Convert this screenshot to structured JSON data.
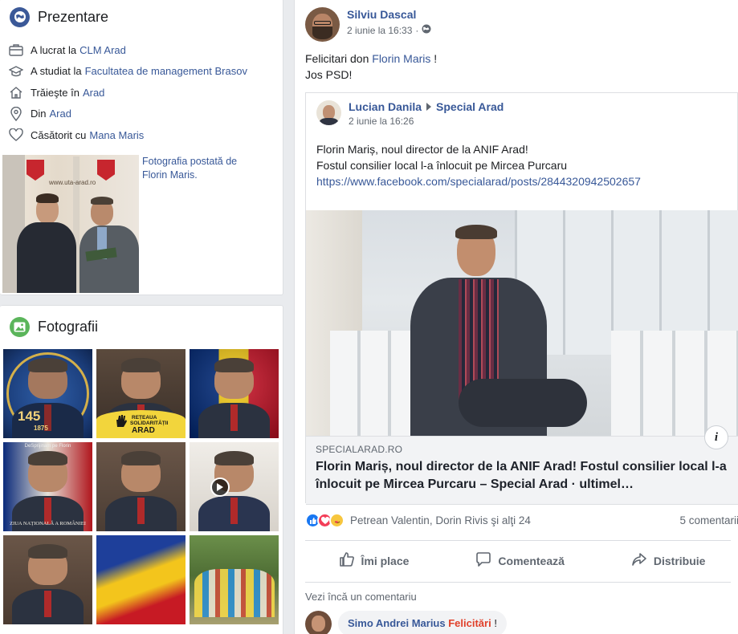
{
  "intro": {
    "title": "Prezentare",
    "items": [
      {
        "prefix": "A lucrat la",
        "link": "CLM Arad",
        "icon": "briefcase-icon"
      },
      {
        "prefix": "A studiat la",
        "link": "Facultatea de management Brasov",
        "icon": "graduation-cap-icon"
      },
      {
        "prefix": "Trăieşte în",
        "link": "Arad",
        "icon": "home-icon"
      },
      {
        "prefix": "Din",
        "link": "Arad",
        "icon": "location-pin-icon"
      },
      {
        "prefix": "Căsătorit cu",
        "link": "Mana Maris",
        "icon": "heart-icon"
      }
    ],
    "featured_caption": "Fotografia postată de Florin Maris.",
    "featured_sign": "www.uta-arad.ro"
  },
  "photos": {
    "title": "Fotografii",
    "tile_captions": {
      "t1_number": "145",
      "t1_year": "1875",
      "t2_line1": "REȚEAUA",
      "t2_line2": "SOLIDARITĂȚII",
      "t2_line3": "ARAD",
      "t4_top": "DeSprijinam pe Florin",
      "t4_bottom": "ZIUA NAȚIONALĂ A ROMÂNIEI"
    },
    "colors": {
      "romania_blue": "#002b7f",
      "romania_yellow": "#fcd116",
      "romania_red": "#ce1126"
    }
  },
  "post": {
    "author": "Silviu Dascal",
    "time": "2 iunie la 16:33",
    "privacy_icon": "globe-icon",
    "text_prefix": "Felicitari don",
    "text_link": "Florin Maris",
    "text_suffix": " !",
    "text_line2": "Jos PSD!",
    "shared": {
      "author": "Lucian Danila",
      "target": "Special Arad",
      "time": "2 iunie la 16:26",
      "line1": "Florin Mariș, noul director de la ANIF Arad!",
      "line2": "Fostul consilier local l-a înlocuit pe Mircea Purcaru",
      "url": "https://www.facebook.com/specialarad/posts/2844320942502657",
      "link_domain": "SPECIALARAD.RO",
      "link_title": "Florin Mariș, noul director de la ANIF Arad! Fostul consilier local l-a înlocuit pe Mircea Purcaru – Special Arad · ultimel…",
      "info_glyph": "i"
    },
    "reactions": {
      "names": "Petrean Valentin, Dorin Rivis şi alţi 24",
      "comments": "5 comentarii",
      "types": [
        "like-icon",
        "love-icon",
        "care-icon"
      ]
    },
    "actions": {
      "like": "Îmi place",
      "comment": "Comentează",
      "share": "Distribuie"
    },
    "more_comments": "Vezi încă un comentariu",
    "comment": {
      "author": "Simo Andrei Marius",
      "text": "Felicitări",
      "suffix": " !"
    }
  },
  "colors": {
    "link": "#385898",
    "page_bg": "#e9ebee",
    "secondary_text": "#606770",
    "like_blue": "#1877f2",
    "love_red": "#f33e58"
  }
}
